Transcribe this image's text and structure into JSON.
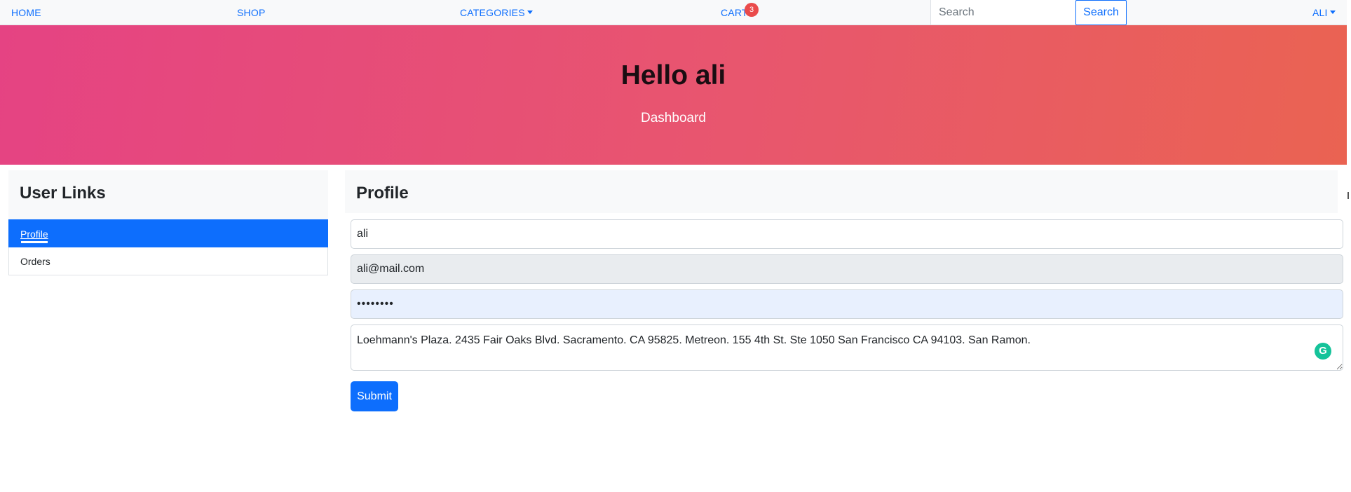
{
  "navbar": {
    "home": "HOME",
    "shop": "SHOP",
    "categories": "CATEGORIES",
    "cart": "CART",
    "cart_count": "3",
    "search_placeholder": "Search",
    "search_button": "Search",
    "user": "ALI"
  },
  "hero": {
    "title": "Hello ali",
    "subtitle": "Dashboard"
  },
  "sidebar": {
    "title": "User Links",
    "items": [
      {
        "label": "Profile",
        "active": true
      },
      {
        "label": "Orders",
        "active": false
      }
    ]
  },
  "profile": {
    "title": "Profile",
    "name_value": "ali",
    "email_value": "ali@mail.com",
    "password_value": "••••••••",
    "address_value": "Loehmann's Plaza. 2435 Fair Oaks Blvd. Sacramento. CA 95825. Metreon. 155 4th St. Ste 1050 San Francisco CA 94103. San Ramon.",
    "submit_label": "Submit"
  },
  "colors": {
    "primary": "#0d6efd",
    "hero_gradient_start": "#e54383",
    "hero_gradient_end": "#ea6352",
    "badge": "#ea4b4b"
  },
  "icons": {
    "dropdown_caret": "caret-down-icon",
    "grammarly": "grammarly-icon"
  }
}
